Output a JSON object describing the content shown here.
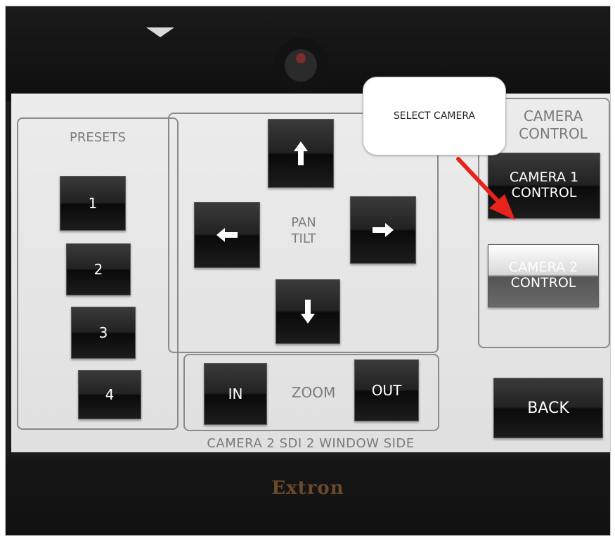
{
  "callout": {
    "text": "SELECT CAMERA"
  },
  "presets": {
    "label": "PRESETS",
    "buttons": [
      "1",
      "2",
      "3",
      "4"
    ]
  },
  "pan_tilt": {
    "label_line1": "PAN",
    "label_line2": "TILT",
    "icons": {
      "up": "arrow-up-icon",
      "down": "arrow-down-icon",
      "left": "arrow-left-icon",
      "right": "arrow-right-icon"
    }
  },
  "zoom": {
    "label": "ZOOM",
    "in_label": "IN",
    "out_label": "OUT"
  },
  "camera_control": {
    "label_line1": "CAMERA",
    "label_line2": "CONTROL",
    "camera1": {
      "line1": "CAMERA 1",
      "line2": "CONTROL"
    },
    "camera2": {
      "line1": "CAMERA 2",
      "line2": "CONTROL"
    }
  },
  "back_label": "BACK",
  "status_text": "CAMERA 2 SDI 2 WINDOW SIDE",
  "brand": "Extron",
  "colors": {
    "annotation_arrow": "#e8231b",
    "button_dark": "#111111",
    "panel_border": "#8a8a8a",
    "screen_bg": "#e6e6e6"
  }
}
